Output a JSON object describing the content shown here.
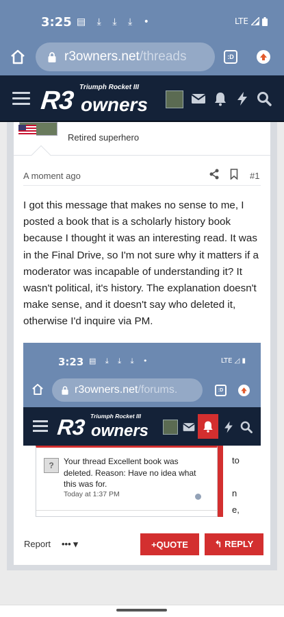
{
  "status_bar": {
    "time": "3:25",
    "notification_icons": "▤ ⤓ ⤓ ⤓ •",
    "network": "LTE"
  },
  "browser": {
    "url_host": "r3owners.net",
    "url_path": "/threads",
    "tabs_label": ":D"
  },
  "site": {
    "logo_main": "R3",
    "logo_sub": "Triumph Rocket III",
    "logo_owners": "owners"
  },
  "post": {
    "user_title": "Retired superhero",
    "timestamp": "A moment ago",
    "post_number": "#1",
    "body": "I got this message that makes no sense to me, I posted a book that is a scholarly history book because I thought it was an interesting read. It was in the Final Drive, so I'm not sure why it matters if a moderator was incapable of understanding it? It wasn't political, it's history. The explanation doesn't make sense, and it doesn't say who deleted it, otherwise I'd inquire via PM."
  },
  "embedded_screenshot": {
    "time": "3:23",
    "notification_icons": "▤ ⤓ ⤓ ⤓ •",
    "network": "LTE",
    "url_host": "r3owners.net",
    "url_path": "/forums.",
    "tabs_label": ":D",
    "logo_main": "R3",
    "logo_sub": "Triumph Rocket III",
    "logo_owners": "owners",
    "notification": {
      "avatar_glyph": "?",
      "text": "Your thread Excellent book was deleted. Reason: Have no idea what this was for.",
      "time": "Today at 1:37 PM"
    },
    "behind_text": [
      "to",
      "n",
      "e,"
    ]
  },
  "actions": {
    "report": "Report",
    "more": "••• ▾",
    "quote": "+QUOTE",
    "reply": "↰ REPLY"
  },
  "colors": {
    "status_bar": "#6c89b1",
    "site_header": "#142238",
    "accent_red": "#d32f2f"
  },
  "icons": [
    "home-icon",
    "lock-icon",
    "tabs-icon",
    "update-icon",
    "hamburger-icon",
    "mail-icon",
    "bell-icon",
    "lightning-icon",
    "search-icon",
    "share-icon",
    "bookmark-icon",
    "us-flag-icon"
  ]
}
